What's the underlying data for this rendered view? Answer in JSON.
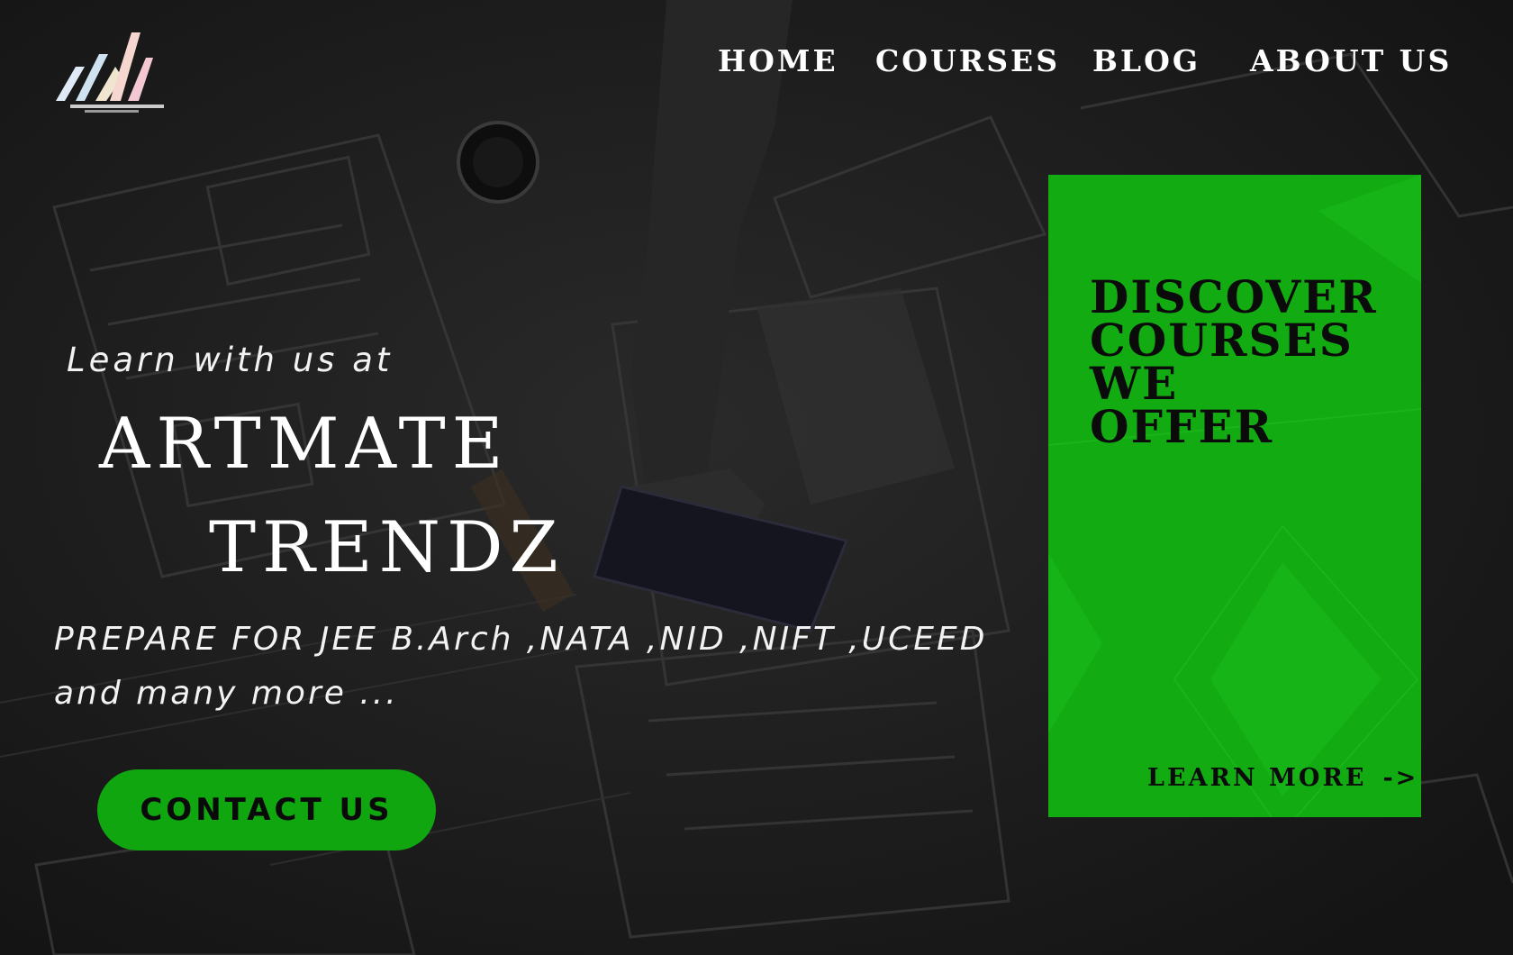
{
  "header": {
    "logo_icon": "artmate-trendz-logo",
    "nav": {
      "home": "HOME",
      "courses": "COURSES",
      "blog": "BLOG",
      "about": "ABOUT US"
    }
  },
  "hero": {
    "intro": "Learn with us at",
    "brand_line1": "ARTMATE",
    "brand_line2": "TRENDZ",
    "subtitle_line1": "PREPARE FOR JEE B.Arch ,NATA ,NID ,NIFT ,UCEED",
    "subtitle_line2": "and many more ...",
    "contact_label": "CONTACT US"
  },
  "card": {
    "title_lines": [
      "DISCOVER",
      "COURSES",
      "WE",
      "OFFER"
    ],
    "link_label": "LEARN  MORE",
    "link_arrow": "->"
  },
  "colors": {
    "accent_green": "#12ab12",
    "button_green": "#0fa60f",
    "background": "#1b1b1b",
    "text_light": "#ffffff",
    "text_dark": "#0b0b0b"
  }
}
